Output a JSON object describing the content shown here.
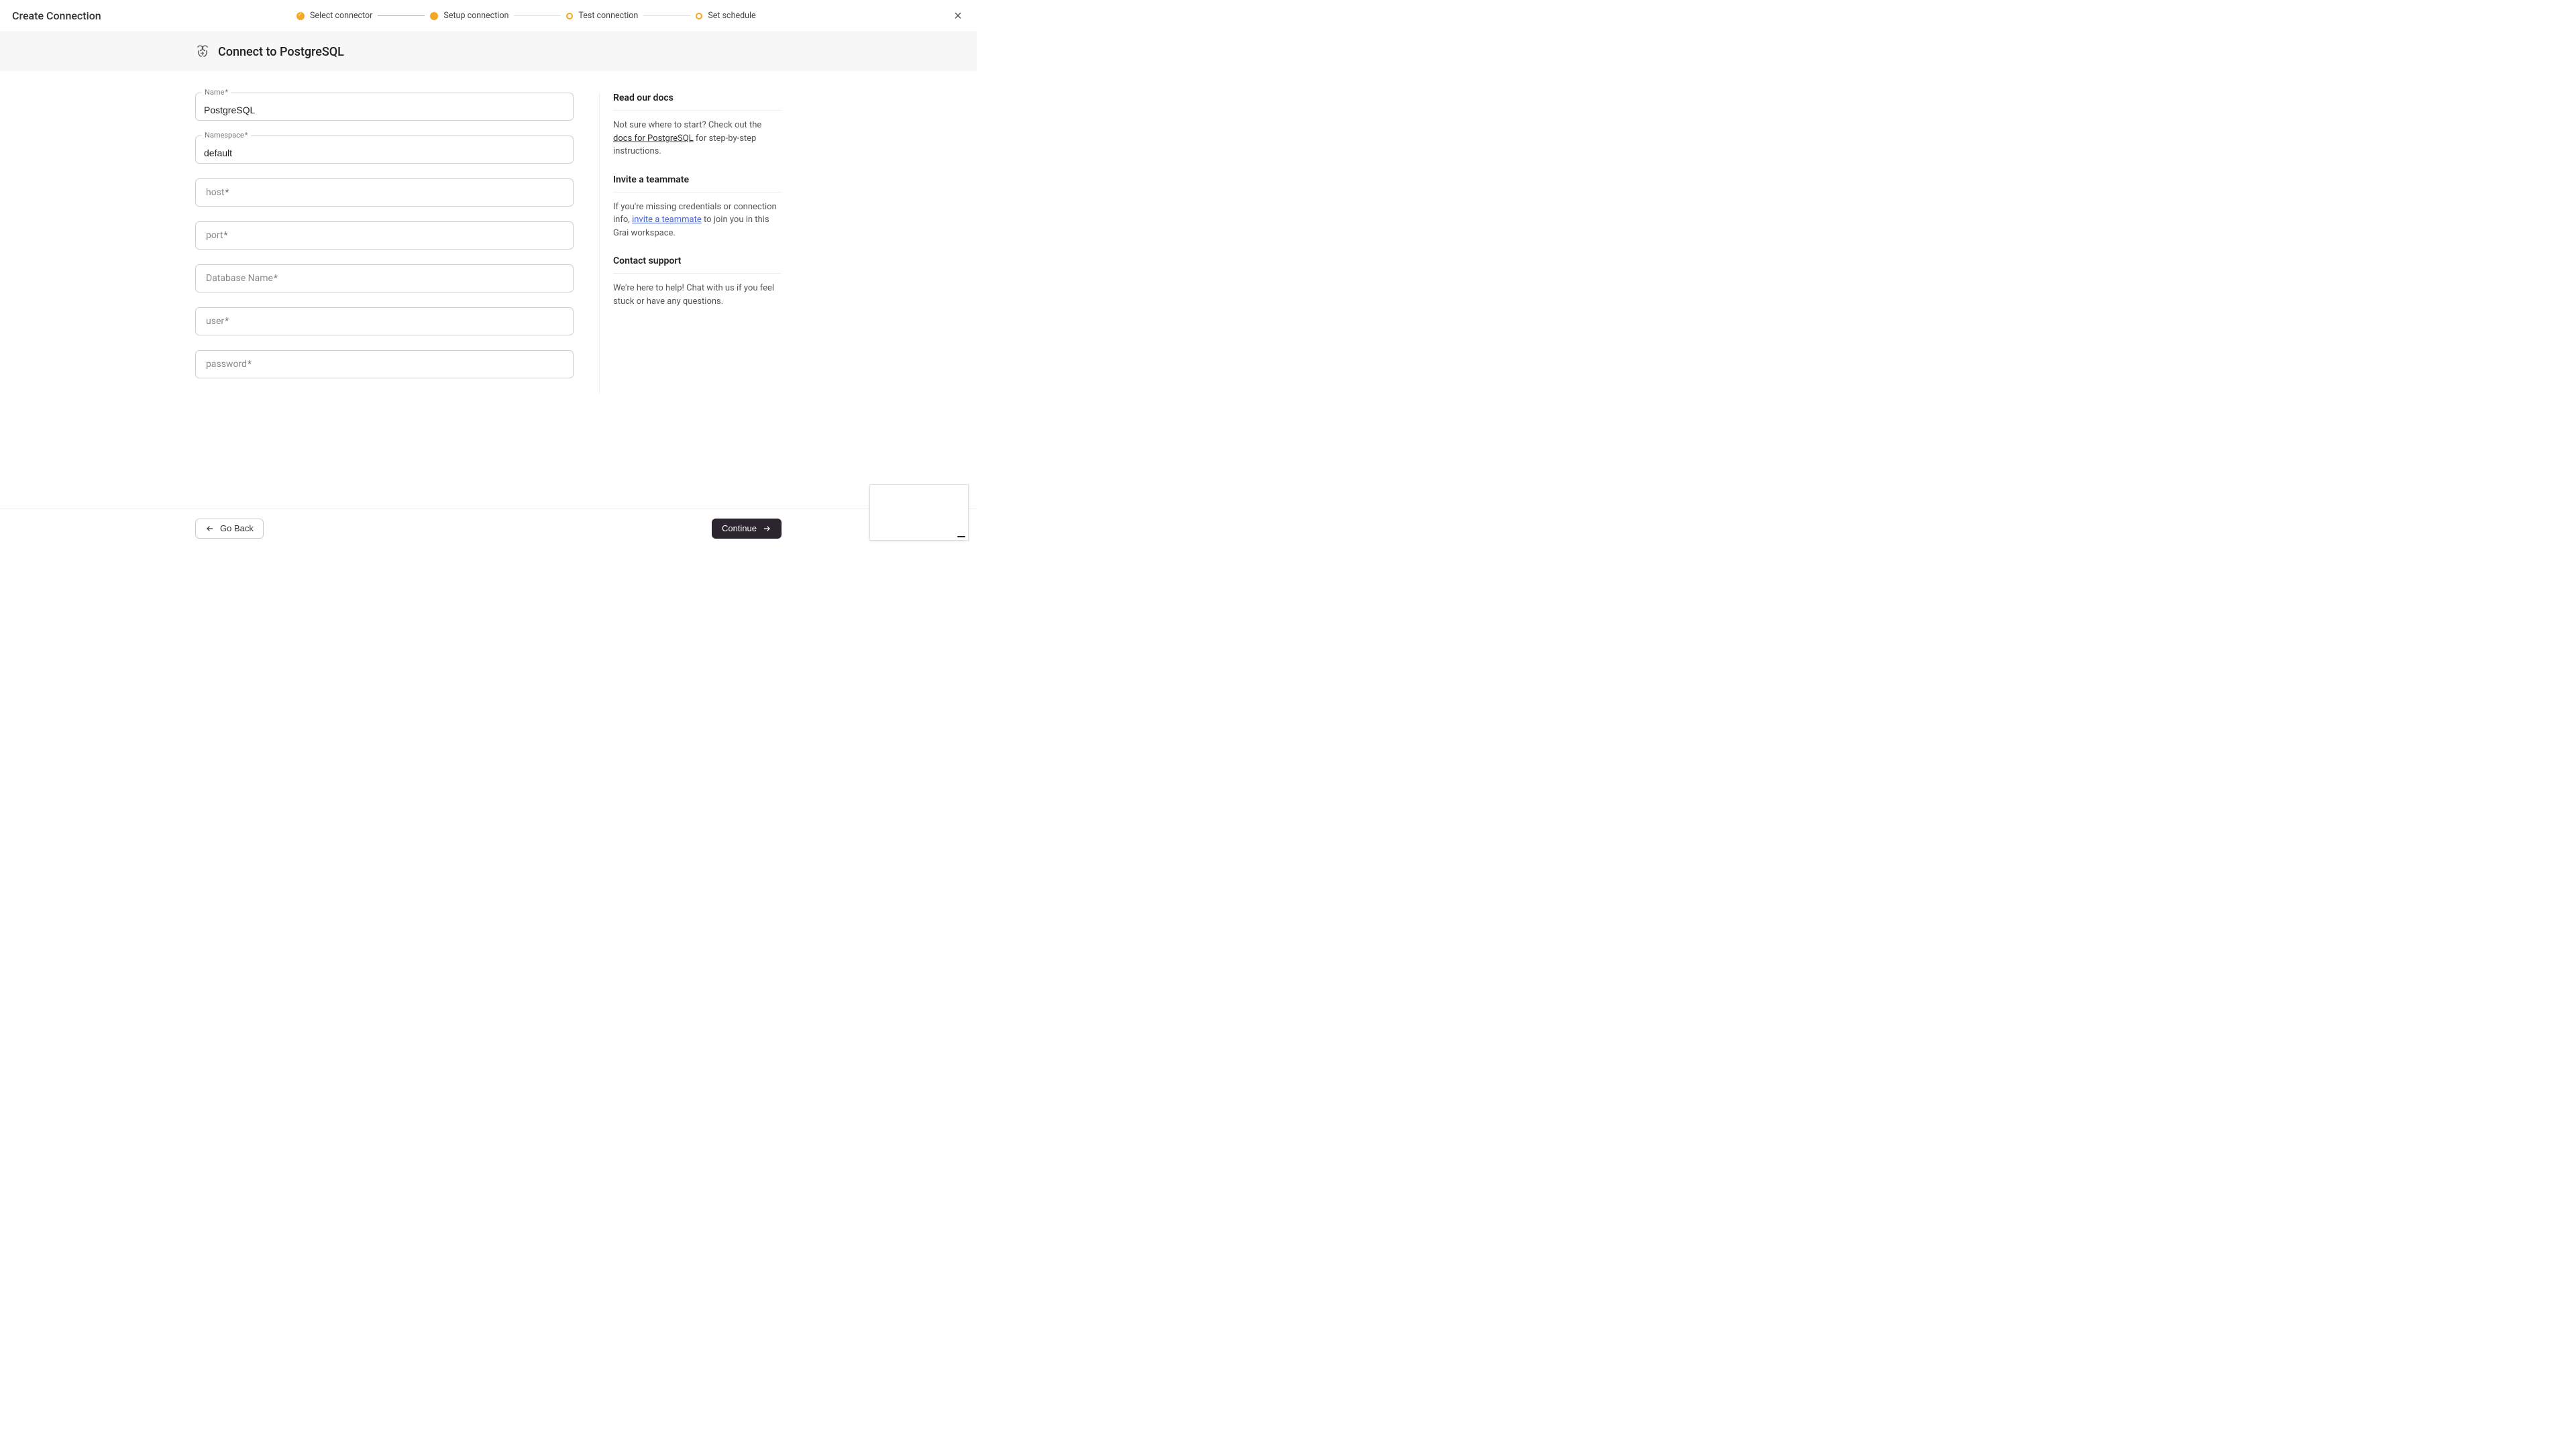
{
  "header": {
    "title": "Create Connection",
    "steps": [
      {
        "label": "Select connector",
        "state": "done"
      },
      {
        "label": "Setup connection",
        "state": "current"
      },
      {
        "label": "Test connection",
        "state": "todo"
      },
      {
        "label": "Set schedule",
        "state": "todo"
      }
    ]
  },
  "subheader": {
    "title": "Connect to PostgreSQL"
  },
  "form": {
    "name": {
      "label": "Name",
      "required": true,
      "value": "PostgreSQL"
    },
    "namespace": {
      "label": "Namespace",
      "required": true,
      "value": "default"
    },
    "host": {
      "label": "host",
      "required": true,
      "value": ""
    },
    "port": {
      "label": "port",
      "required": true,
      "value": ""
    },
    "dbname": {
      "label": "Database Name",
      "required": true,
      "value": ""
    },
    "user": {
      "label": "user",
      "required": true,
      "value": ""
    },
    "password": {
      "label": "password",
      "required": true,
      "value": ""
    }
  },
  "sidebar": {
    "docs": {
      "heading": "Read our docs",
      "text_before": "Not sure where to start? Check out the ",
      "link_text": "docs for PostgreSQL",
      "text_after": " for step-by-step instructions."
    },
    "invite": {
      "heading": "Invite a teammate",
      "text_before": "If you're missing credentials or connection info, ",
      "link_text": "invite a teammate",
      "text_after": " to join you in this Grai workspace."
    },
    "support": {
      "heading": "Contact support",
      "text": "We're here to help! Chat with us if you feel stuck or have any questions."
    }
  },
  "footer": {
    "back_label": "Go Back",
    "continue_label": "Continue"
  },
  "required_indicator": "*"
}
